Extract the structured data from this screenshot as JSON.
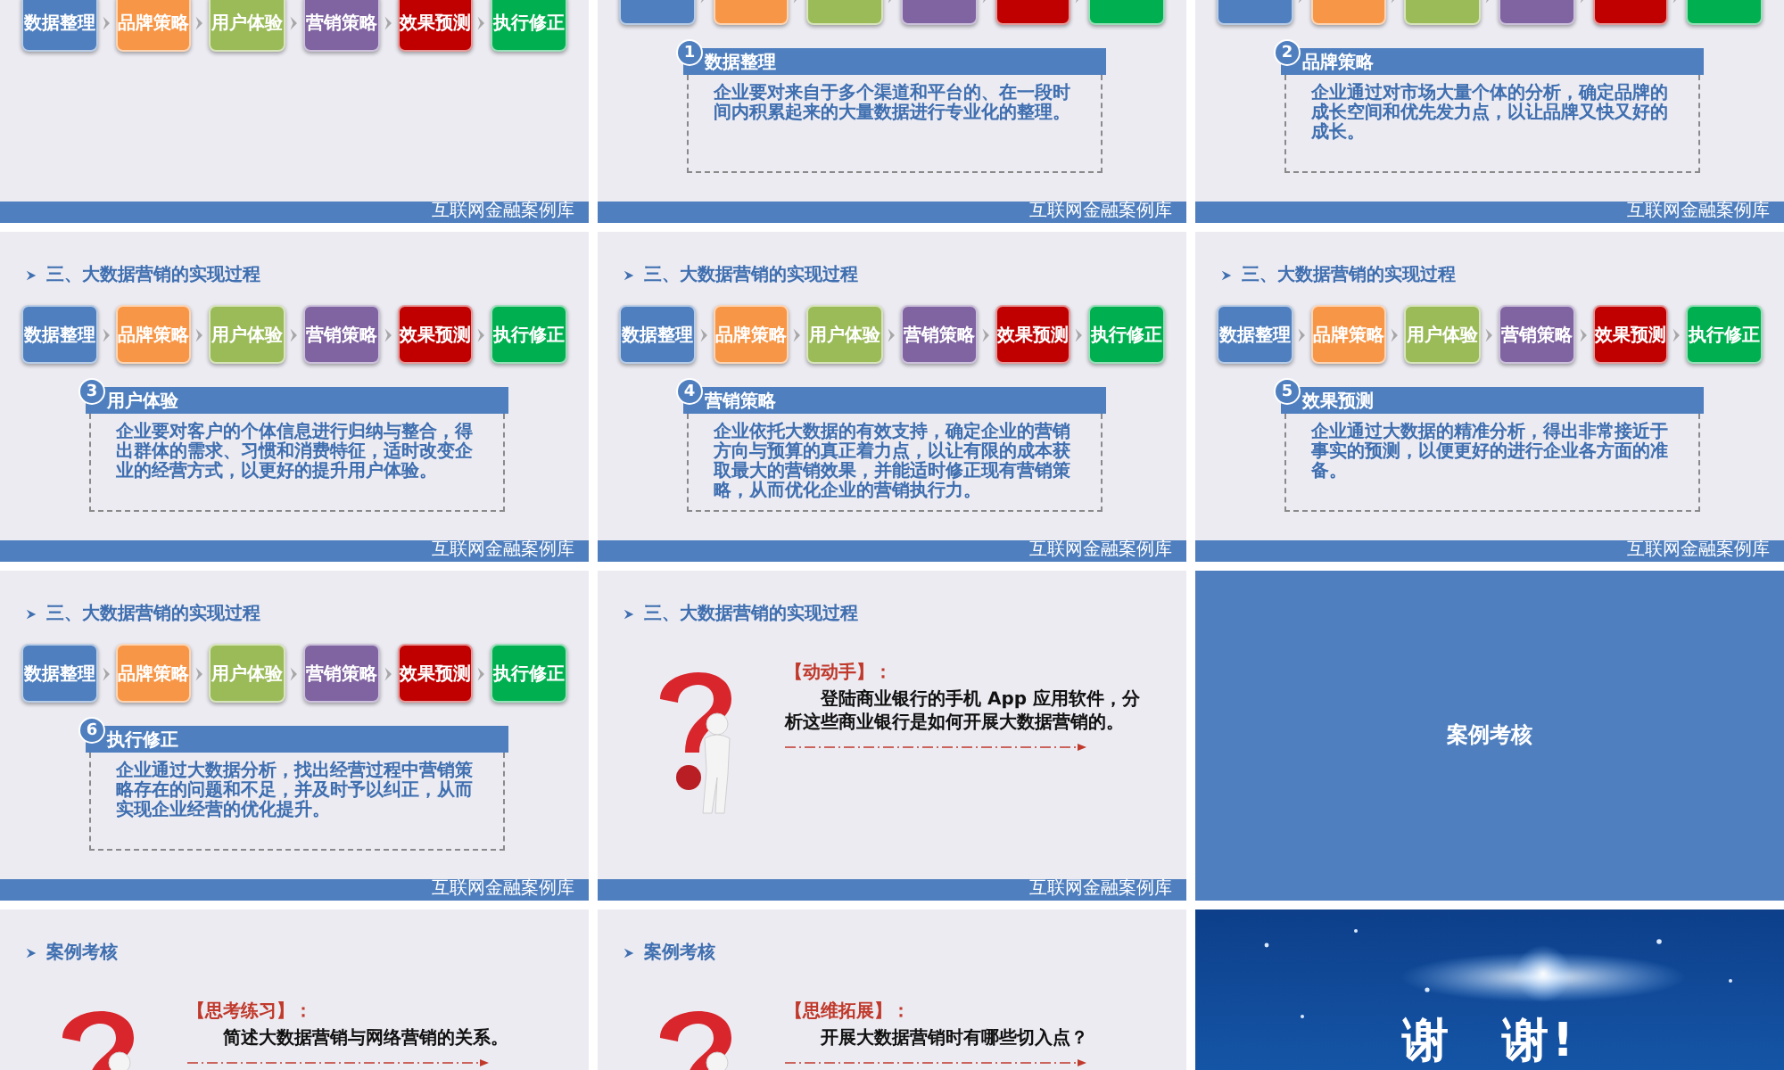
{
  "slides": [
    {
      "kind": "overview",
      "steps": [
        {
          "label": "数据整理",
          "color": "#4f7fbf"
        },
        {
          "label": "品牌策略",
          "color": "#f79646"
        },
        {
          "label": "用户体验",
          "color": "#9bbb59"
        },
        {
          "label": "营销策略",
          "color": "#8064a2"
        },
        {
          "label": "效果预测",
          "color": "#c00000"
        },
        {
          "label": "执行修正",
          "color": "#00b050"
        }
      ],
      "footer": "互联网金融案例库"
    },
    {
      "kind": "detail",
      "steps": [
        {
          "color": "#4f7fbf"
        },
        {
          "color": "#f79646"
        },
        {
          "color": "#9bbb59"
        },
        {
          "color": "#8064a2"
        },
        {
          "color": "#c00000"
        },
        {
          "color": "#00b050"
        }
      ],
      "number": "1",
      "title": "数据整理",
      "text": "企业要对来自于多个渠道和平台的、在一段时间内积累起来的大量数据进行专业化的整理。",
      "footer": "互联网金融案例库"
    },
    {
      "kind": "detail",
      "steps": [
        {
          "color": "#4f7fbf"
        },
        {
          "color": "#f79646"
        },
        {
          "color": "#9bbb59"
        },
        {
          "color": "#8064a2"
        },
        {
          "color": "#c00000"
        },
        {
          "color": "#00b050"
        }
      ],
      "number": "2",
      "title": "品牌策略",
      "text": "企业通过对市场大量个体的分析，确定品牌的成长空间和优先发力点，以让品牌又快又好的成长。",
      "footer": "互联网金融案例库"
    },
    {
      "kind": "detail",
      "heading": "三、大数据营销的实现过程",
      "steps": [
        {
          "label": "数据整理",
          "color": "#4f7fbf"
        },
        {
          "label": "品牌策略",
          "color": "#f79646"
        },
        {
          "label": "用户体验",
          "color": "#9bbb59"
        },
        {
          "label": "营销策略",
          "color": "#8064a2"
        },
        {
          "label": "效果预测",
          "color": "#c00000"
        },
        {
          "label": "执行修正",
          "color": "#00b050"
        }
      ],
      "number": "3",
      "title": "用户体验",
      "text": "企业要对客户的个体信息进行归纳与整合，得出群体的需求、习惯和消费特征，适时改变企业的经营方式，以更好的提升用户体验。",
      "footer": "互联网金融案例库"
    },
    {
      "kind": "detail",
      "heading": "三、大数据营销的实现过程",
      "steps": [
        {
          "label": "数据整理",
          "color": "#4f7fbf"
        },
        {
          "label": "品牌策略",
          "color": "#f79646"
        },
        {
          "label": "用户体验",
          "color": "#9bbb59"
        },
        {
          "label": "营销策略",
          "color": "#8064a2"
        },
        {
          "label": "效果预测",
          "color": "#c00000"
        },
        {
          "label": "执行修正",
          "color": "#00b050"
        }
      ],
      "number": "4",
      "title": "营销策略",
      "text": "企业依托大数据的有效支持，确定企业的营销方向与预算的真正着力点，以让有限的成本获取最大的营销效果，并能适时修正现有营销策略，从而优化企业的营销执行力。",
      "footer": "互联网金融案例库"
    },
    {
      "kind": "detail",
      "heading": "三、大数据营销的实现过程",
      "steps": [
        {
          "label": "数据整理",
          "color": "#4f7fbf"
        },
        {
          "label": "品牌策略",
          "color": "#f79646"
        },
        {
          "label": "用户体验",
          "color": "#9bbb59"
        },
        {
          "label": "营销策略",
          "color": "#8064a2"
        },
        {
          "label": "效果预测",
          "color": "#c00000"
        },
        {
          "label": "执行修正",
          "color": "#00b050"
        }
      ],
      "number": "5",
      "title": "效果预测",
      "text": "企业通过大数据的精准分析，得出非常接近于事实的预测，以便更好的进行企业各方面的准备。",
      "footer": "互联网金融案例库"
    },
    {
      "kind": "detail",
      "heading": "三、大数据营销的实现过程",
      "steps": [
        {
          "label": "数据整理",
          "color": "#4f7fbf"
        },
        {
          "label": "品牌策略",
          "color": "#f79646"
        },
        {
          "label": "用户体验",
          "color": "#9bbb59"
        },
        {
          "label": "营销策略",
          "color": "#8064a2"
        },
        {
          "label": "效果预测",
          "color": "#c00000"
        },
        {
          "label": "执行修正",
          "color": "#00b050"
        }
      ],
      "number": "6",
      "title": "执行修正",
      "text": "企业通过大数据分析，找出经营过程中营销策略存在的问题和不足，并及时予以纠正，从而实现企业经营的优化提升。",
      "footer": "互联网金融案例库"
    },
    {
      "kind": "exercise",
      "heading": "三、大数据营销的实现过程",
      "prompt": "【动动手】：",
      "text": "登陆商业银行的手机 App 应用软件，分析这些商业银行是如何开展大数据营销的。",
      "footer": "互联网金融案例库"
    },
    {
      "kind": "section",
      "title": "案例考核"
    },
    {
      "kind": "exercise",
      "heading": "案例考核",
      "prompt": "【思考练习】：",
      "text": "简述大数据营销与网络营销的关系。"
    },
    {
      "kind": "exercise",
      "heading": "案例考核",
      "prompt": "【思维拓展】：",
      "text": "开展大数据营销时有哪些切入点？"
    },
    {
      "kind": "closing",
      "title": "谢　谢!"
    }
  ]
}
